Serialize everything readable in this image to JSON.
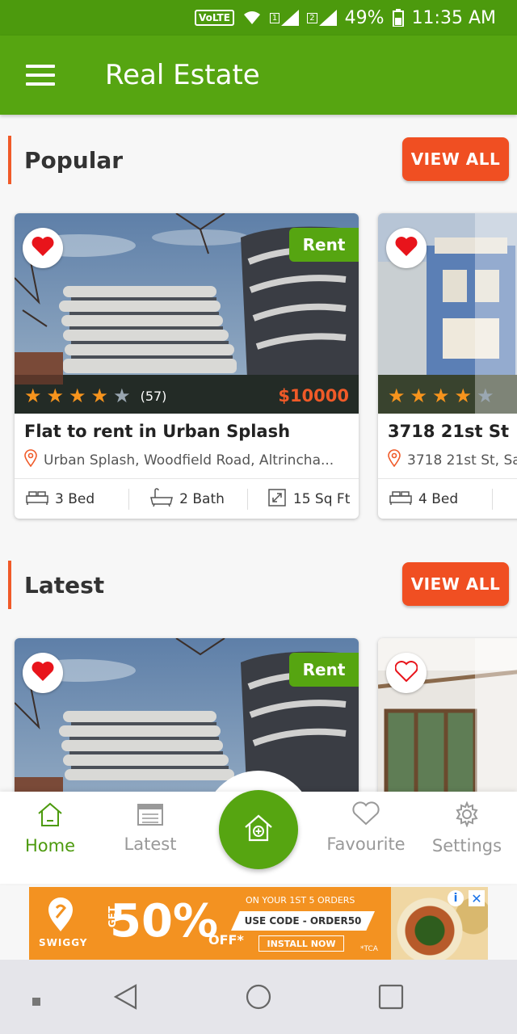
{
  "status_bar": {
    "volte": "VoLTE",
    "sim1": "1",
    "sim2": "2",
    "battery": "49%",
    "time": "11:35 AM"
  },
  "app_bar": {
    "title": "Real Estate",
    "menu_icon": "hamburger-menu-icon"
  },
  "sections": {
    "popular": {
      "title": "Popular",
      "view_all": "VIEW ALL",
      "cards": [
        {
          "badge": "Rent",
          "rating_count": "(57)",
          "price": "$10000",
          "title": "Flat to rent in Urban Splash",
          "address": "Urban Splash, Woodfield Road, Altrincha...",
          "beds": "3 Bed",
          "baths": "2 Bath",
          "area": "15 Sq Ft",
          "stars_filled": 4,
          "stars_total": 5
        },
        {
          "title": "3718 21st St",
          "address": "3718 21st St, Sa",
          "beds": "4 Bed",
          "stars_filled": 4,
          "stars_total": 5
        }
      ]
    },
    "latest": {
      "title": "Latest",
      "view_all": "VIEW ALL",
      "cards": [
        {
          "badge": "Rent"
        },
        {}
      ]
    }
  },
  "bottom_nav": {
    "items": [
      {
        "label": "Home",
        "icon": "home-icon",
        "active": true
      },
      {
        "label": "Latest",
        "icon": "calendar-icon",
        "active": false
      },
      {
        "label": "Favourite",
        "icon": "heart-outline-icon",
        "active": false
      },
      {
        "label": "Settings",
        "icon": "gear-icon",
        "active": false
      }
    ],
    "fab_icon": "add-home-icon"
  },
  "ad": {
    "brand": "SWIGGY",
    "get": "GET",
    "big": "50%",
    "off": "OFF*",
    "orders": "ON YOUR 1ST 5 ORDERS",
    "code": "USE CODE - ORDER50",
    "install": "INSTALL NOW",
    "tca": "*TCA"
  },
  "colors": {
    "primary_green": "#56a511",
    "accent_orange": "#f04f22",
    "price_orange": "#f05a28",
    "star": "#f7941d"
  }
}
